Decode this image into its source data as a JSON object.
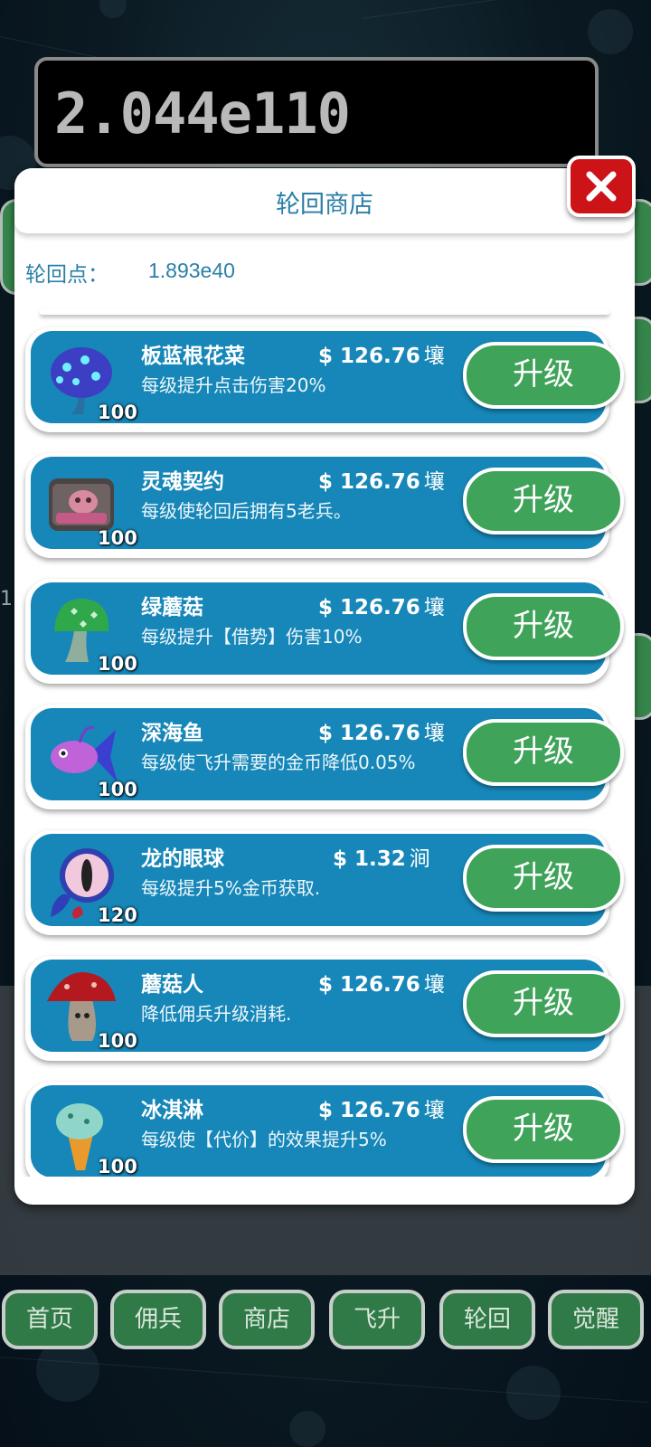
{
  "score": "2.044e110",
  "shop": {
    "title": "轮回商店",
    "points_label": "轮回点：",
    "points_value": "1.893e40",
    "upgrade_label": "升级",
    "items": [
      {
        "name": "板蓝根花菜",
        "price": "$ 126.76",
        "unit": "壤",
        "desc": "每级提升点击伤害20%",
        "level": "100",
        "icon": "blue-cauliflower-icon"
      },
      {
        "name": "灵魂契约",
        "price": "$ 126.76",
        "unit": "壤",
        "desc": "每级使轮回后拥有5老兵。",
        "level": "100",
        "icon": "soul-scroll-icon"
      },
      {
        "name": "绿蘑菇",
        "price": "$ 126.76",
        "unit": "壤",
        "desc": "每级提升【借势】伤害10%",
        "level": "100",
        "icon": "green-mushroom-icon"
      },
      {
        "name": "深海鱼",
        "price": "$ 126.76",
        "unit": "壤",
        "desc": "每级使飞升需要的金币降低0.05%",
        "level": "100",
        "icon": "deep-sea-fish-icon"
      },
      {
        "name": "龙的眼球",
        "price": "$ 1.32",
        "unit": "涧",
        "desc": "每级提升5%金币获取.",
        "level": "120",
        "icon": "dragon-eye-icon"
      },
      {
        "name": "蘑菇人",
        "price": "$ 126.76",
        "unit": "壤",
        "desc": "降低佣兵升级消耗.",
        "level": "100",
        "icon": "mushroom-man-icon"
      },
      {
        "name": "冰淇淋",
        "price": "$ 126.76",
        "unit": "壤",
        "desc": "每级使【代价】的效果提升5%",
        "level": "100",
        "icon": "ice-cream-icon"
      }
    ]
  },
  "background_number": "1",
  "nav": [
    "首页",
    "佣兵",
    "商店",
    "飞升",
    "轮回",
    "觉醒"
  ],
  "colors": {
    "card_blue": "#1687b8",
    "button_green": "#3fa35a",
    "close_red": "#cc1418",
    "title_blue": "#2a7fa8"
  }
}
